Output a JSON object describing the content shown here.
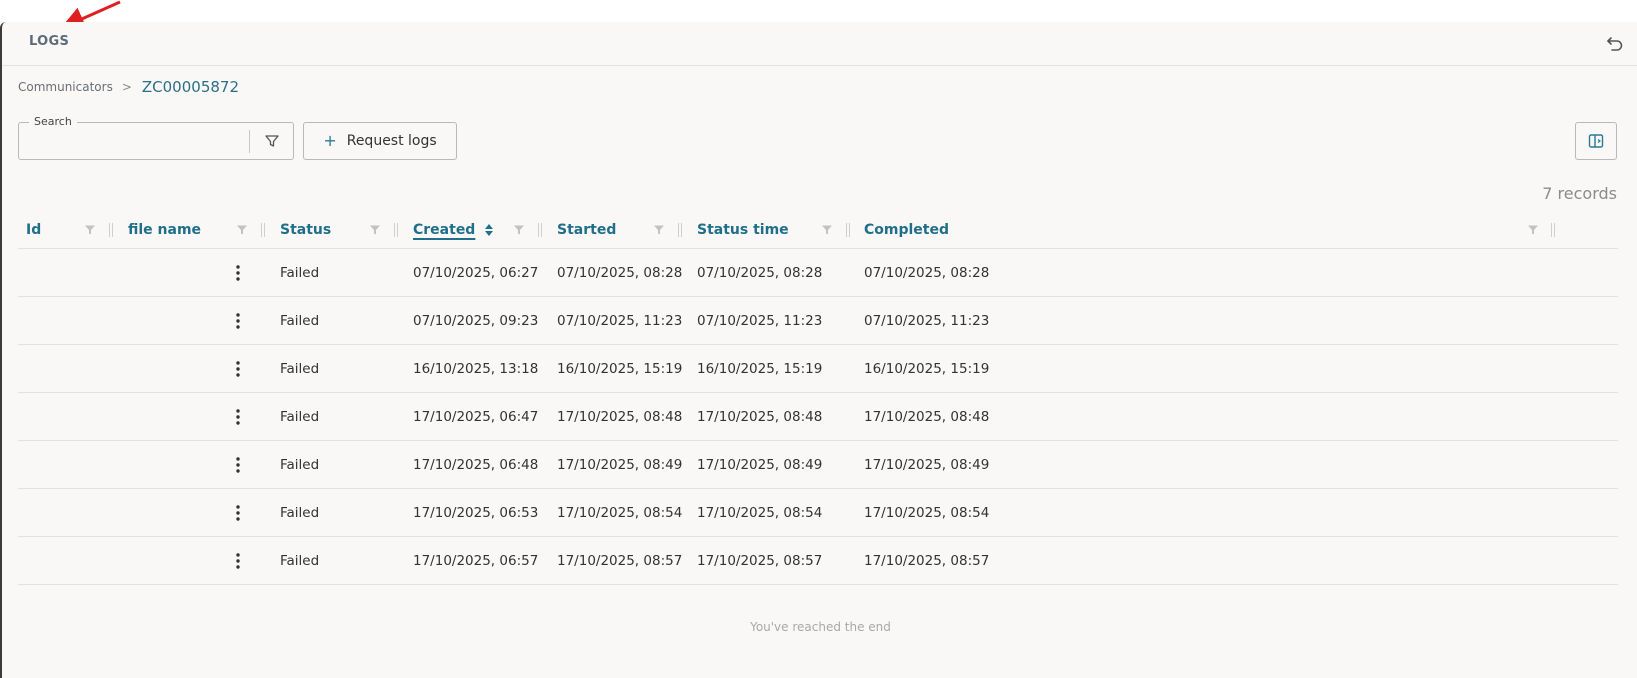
{
  "header": {
    "title": "LOGS"
  },
  "breadcrumb": {
    "parent": "Communicators",
    "separator": ">",
    "current": "ZC00005872"
  },
  "search": {
    "label": "Search",
    "value": ""
  },
  "toolbar": {
    "request_logs_label": "Request logs"
  },
  "records": {
    "count": "7 records"
  },
  "table": {
    "columns": [
      "Id",
      "file name",
      "Status",
      "Created",
      "Started",
      "Status time",
      "Completed"
    ],
    "sorted_column": "Created",
    "rows": [
      {
        "id": "",
        "file_name": "",
        "status": "Failed",
        "created": "07/10/2025, 06:27",
        "started": "07/10/2025, 08:28",
        "status_time": "07/10/2025, 08:28",
        "completed": "07/10/2025, 08:28"
      },
      {
        "id": "",
        "file_name": "",
        "status": "Failed",
        "created": "07/10/2025, 09:23",
        "started": "07/10/2025, 11:23",
        "status_time": "07/10/2025, 11:23",
        "completed": "07/10/2025, 11:23"
      },
      {
        "id": "",
        "file_name": "",
        "status": "Failed",
        "created": "16/10/2025, 13:18",
        "started": "16/10/2025, 15:19",
        "status_time": "16/10/2025, 15:19",
        "completed": "16/10/2025, 15:19"
      },
      {
        "id": "",
        "file_name": "",
        "status": "Failed",
        "created": "17/10/2025, 06:47",
        "started": "17/10/2025, 08:48",
        "status_time": "17/10/2025, 08:48",
        "completed": "17/10/2025, 08:48"
      },
      {
        "id": "",
        "file_name": "",
        "status": "Failed",
        "created": "17/10/2025, 06:48",
        "started": "17/10/2025, 08:49",
        "status_time": "17/10/2025, 08:49",
        "completed": "17/10/2025, 08:49"
      },
      {
        "id": "",
        "file_name": "",
        "status": "Failed",
        "created": "17/10/2025, 06:53",
        "started": "17/10/2025, 08:54",
        "status_time": "17/10/2025, 08:54",
        "completed": "17/10/2025, 08:54"
      },
      {
        "id": "",
        "file_name": "",
        "status": "Failed",
        "created": "17/10/2025, 06:57",
        "started": "17/10/2025, 08:57",
        "status_time": "17/10/2025, 08:57",
        "completed": "17/10/2025, 08:57"
      }
    ]
  },
  "footer": {
    "end_message": "You've reached the end"
  },
  "colors": {
    "accent": "#1f6f8b",
    "arrow": "#e02020",
    "background": "#f9f8f6"
  },
  "icons": {
    "undo": "undo-icon",
    "filter": "filter-icon",
    "plus": "plus-icon",
    "side_panel": "side-panel-icon",
    "kebab": "kebab-menu-icon"
  }
}
